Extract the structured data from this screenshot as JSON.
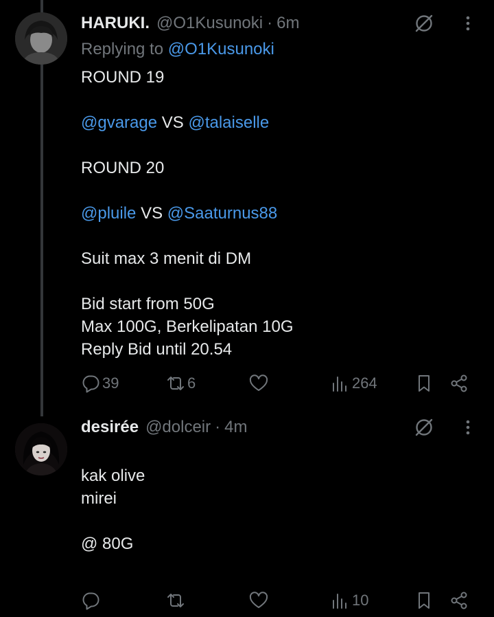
{
  "tweets": [
    {
      "author": {
        "name": "HARUKI.",
        "handle": "@O1Kusunoki",
        "time": "6m"
      },
      "replying_label": "Replying to",
      "replying_to": "@O1Kusunoki",
      "content": {
        "l1": "ROUND 19",
        "l2_m1": "@gvarage",
        "l2_vs": " VS ",
        "l2_m2": "@talaiselle",
        "l3": "ROUND 20",
        "l4_m1": "@pluile",
        "l4_vs": " VS ",
        "l4_m2": "@Saaturnus88",
        "l5": "Suit max 3 menit di DM",
        "l6": "Bid start from 50G",
        "l7": "Max 100G, Berkelipatan 10G",
        "l8": "Reply Bid until 20.54"
      },
      "stats": {
        "replies": "39",
        "reposts": "6",
        "likes": "",
        "views": "264"
      }
    },
    {
      "author": {
        "name": "desirée",
        "handle": "@dolceir",
        "time": "4m"
      },
      "content": {
        "l1": "kak olive",
        "l2": "mirei",
        "l3": "@ 80G"
      },
      "stats": {
        "replies": "",
        "reposts": "",
        "likes": "",
        "views": "10"
      }
    }
  ],
  "separator": "·",
  "icons": {
    "grok": "grok-icon",
    "more": "more-dots-icon",
    "reply": "reply-icon",
    "repost": "repost-icon",
    "like": "heart-icon",
    "views": "views-chart-icon",
    "bookmark": "bookmark-icon",
    "share": "share-icon"
  },
  "colors": {
    "background": "#000000",
    "text": "#e7e9ea",
    "muted": "#71767b",
    "link": "#4a99e9",
    "thread_line": "#333639"
  }
}
